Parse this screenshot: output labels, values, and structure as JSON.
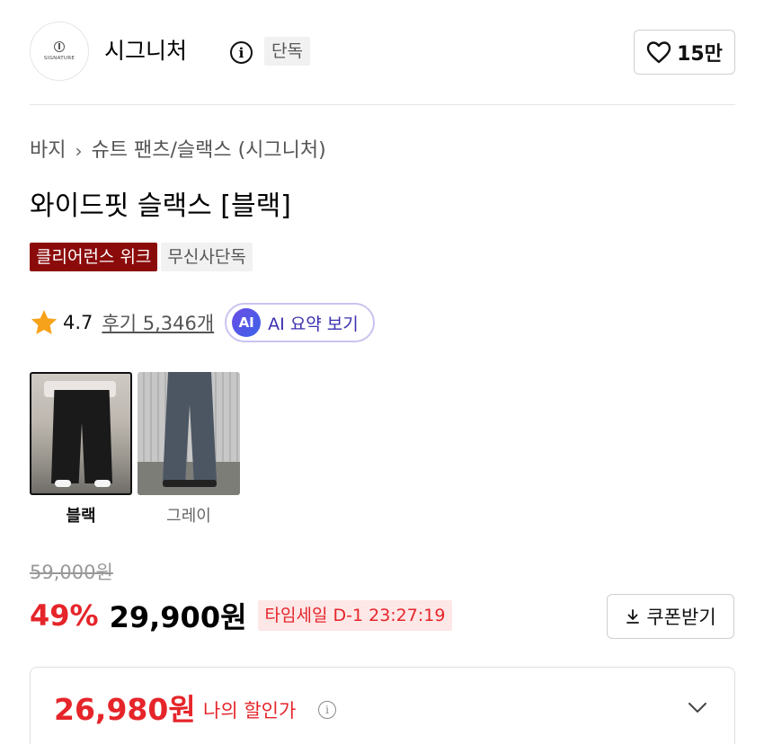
{
  "brand": {
    "logo_text": "SIGNATURE",
    "name": "시그니처",
    "badge": "단독",
    "likes": "15만"
  },
  "breadcrumb": {
    "category": "바지",
    "subcategory": "슈트 팬츠/슬랙스 (시그니처)"
  },
  "product": {
    "title": "와이드핏 슬랙스 [블랙]",
    "tags": [
      "클리어런스 위크",
      "무신사단독"
    ]
  },
  "rating": {
    "score": "4.7",
    "reviews": "후기 5,346개",
    "ai_badge": "AI",
    "ai_label": "AI 요약 보기"
  },
  "options": [
    {
      "label": "블랙",
      "selected": true
    },
    {
      "label": "그레이",
      "selected": false
    }
  ],
  "price": {
    "original": "59,000원",
    "discount": "49%",
    "sale": "29,900원",
    "timesale": "타임세일 D-1 23:27:19",
    "coupon_label": "쿠폰받기"
  },
  "my_price": {
    "amount": "26,980원",
    "label": "나의 할인가"
  },
  "colors": {
    "sale_red": "#e5252a",
    "clearance_tag": "#8b0b0b",
    "ai_purple": "#3b2fb0"
  },
  "icons": {
    "info": "info-icon",
    "heart": "heart-icon",
    "star": "star-icon",
    "download": "download-icon",
    "chevron": "chevron-down-icon"
  }
}
